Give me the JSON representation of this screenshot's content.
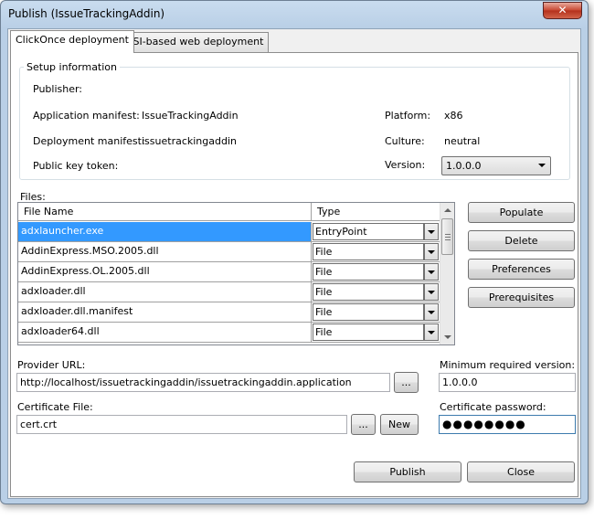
{
  "window": {
    "title": "Publish (IssueTrackingAddin)",
    "close_glyph": "✕"
  },
  "tabs": [
    {
      "label": "ClickOnce deployment",
      "active": true
    },
    {
      "label": "MSI-based web deployment",
      "active": false
    }
  ],
  "setup": {
    "group_title": "Setup information",
    "publisher_label": "Publisher:",
    "publisher_value": "",
    "app_manifest_label": "Application manifest:",
    "app_manifest_value": "IssueTrackingAddin",
    "deploy_manifest_label": "Deployment manifest:",
    "deploy_manifest_value": "issuetrackingaddin",
    "public_key_label": "Public key token:",
    "public_key_value": "",
    "platform_label": "Platform:",
    "platform_value": "x86",
    "culture_label": "Culture:",
    "culture_value": "neutral",
    "version_label": "Version:",
    "version_value": "1.0.0.0"
  },
  "files": {
    "label": "Files:",
    "columns": [
      "File Name",
      "Type"
    ],
    "rows": [
      {
        "name": "adxlauncher.exe",
        "type": "EntryPoint",
        "selected": true
      },
      {
        "name": "AddinExpress.MSO.2005.dll",
        "type": "File",
        "selected": false
      },
      {
        "name": "AddinExpress.OL.2005.dll",
        "type": "File",
        "selected": false
      },
      {
        "name": "adxloader.dll",
        "type": "File",
        "selected": false
      },
      {
        "name": "adxloader.dll.manifest",
        "type": "File",
        "selected": false
      },
      {
        "name": "adxloader64.dll",
        "type": "File",
        "selected": false
      }
    ]
  },
  "side_buttons": {
    "populate": "Populate",
    "delete": "Delete",
    "preferences": "Preferences",
    "prerequisites": "Prerequisites"
  },
  "provider": {
    "label": "Provider URL:",
    "value": "http://localhost/issuetrackingaddin/issuetrackingaddin.application",
    "browse": "..."
  },
  "min_version": {
    "label": "Minimum required version:",
    "value": "1.0.0.0"
  },
  "certificate": {
    "label": "Certificate File:",
    "value": "cert.crt",
    "browse": "...",
    "new_label": "New"
  },
  "cert_password": {
    "label": "Certificate password:",
    "value": "●●●●●●●●"
  },
  "footer": {
    "publish": "Publish",
    "close": "Close"
  },
  "colors": {
    "selection": "#3399ff",
    "title_bar": "#b9cfe6"
  }
}
